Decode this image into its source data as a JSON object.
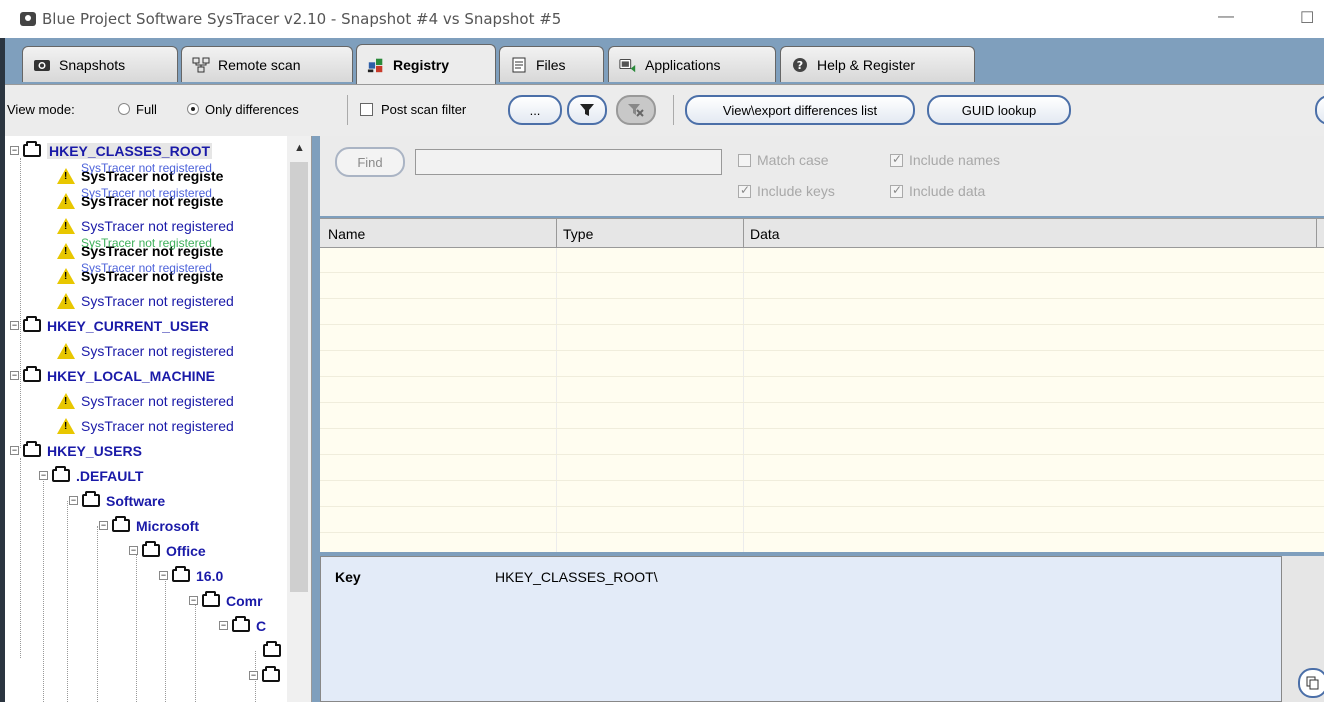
{
  "window": {
    "title": "Blue Project Software SysTracer v2.10 - Snapshot #4 vs Snapshot #5",
    "minimize_glyph": "—",
    "maximize_glyph": "☐"
  },
  "tabs": [
    {
      "label": "Snapshots",
      "icon": "camera-icon"
    },
    {
      "label": "Remote scan",
      "icon": "network-icon"
    },
    {
      "label": "Registry",
      "icon": "registry-icon",
      "active": true
    },
    {
      "label": "Files",
      "icon": "files-icon"
    },
    {
      "label": "Applications",
      "icon": "applications-icon"
    },
    {
      "label": "Help & Register",
      "icon": "help-icon"
    }
  ],
  "toolbar": {
    "view_mode_label": "View mode:",
    "full_label": "Full",
    "only_differences_label": "Only differences",
    "view_mode_selected": "Only differences",
    "post_scan_filter_label": "Post scan filter",
    "post_scan_filter_checked": false,
    "more_button_label": "...",
    "export_button_label": "View\\export differences list",
    "guid_button_label": "GUID lookup"
  },
  "tree": {
    "nodes": [
      {
        "label": "HKEY_CLASSES_ROOT",
        "type": "root",
        "selected": true
      },
      {
        "label": "SysTracer not registered",
        "overlay": "SysTracer not registered",
        "type": "warn-bold",
        "overlay_color": "blue",
        "visible": "SysTracer not registe"
      },
      {
        "label": "SysTracer not registered",
        "overlay": "SysTracer not registered",
        "type": "warn-bold",
        "overlay_color": "blue",
        "visible": "SysTracer not registe"
      },
      {
        "label": "SysTracer not registered",
        "type": "warn"
      },
      {
        "label": "SysTracer not registered",
        "overlay": "SysTracer not registered",
        "type": "warn-bold",
        "overlay_color": "green",
        "visible": "SysTracer not registe"
      },
      {
        "label": "SysTracer not registered",
        "overlay": "SysTracer not registered",
        "type": "warn-bold",
        "overlay_color": "blue",
        "visible": "SysTracer not registe"
      },
      {
        "label": "SysTracer not registered",
        "type": "warn"
      },
      {
        "label": "HKEY_CURRENT_USER",
        "type": "root"
      },
      {
        "label": "SysTracer not registered",
        "type": "warn"
      },
      {
        "label": "HKEY_LOCAL_MACHINE",
        "type": "root"
      },
      {
        "label": "SysTracer not registered",
        "type": "warn"
      },
      {
        "label": "SysTracer not registered",
        "type": "warn"
      },
      {
        "label": "HKEY_USERS",
        "type": "root"
      },
      {
        "label": ".DEFAULT",
        "type": "folder"
      },
      {
        "label": "Software",
        "type": "folder"
      },
      {
        "label": "Microsoft",
        "type": "folder"
      },
      {
        "label": "Office",
        "type": "folder"
      },
      {
        "label": "16.0",
        "type": "folder"
      },
      {
        "label": "Comr",
        "type": "folder"
      },
      {
        "label": "C",
        "type": "folder"
      }
    ]
  },
  "find": {
    "button_label": "Find",
    "input_value": "",
    "match_case_label": "Match case",
    "match_case_checked": false,
    "include_names_label": "Include names",
    "include_names_checked": true,
    "include_keys_label": "Include keys",
    "include_keys_checked": true,
    "include_data_label": "Include data",
    "include_data_checked": true
  },
  "grid": {
    "columns": [
      "Name",
      "Type",
      "Data"
    ],
    "rows": []
  },
  "detail": {
    "key_label": "Key",
    "key_value": "HKEY_CLASSES_ROOT\\"
  },
  "colors": {
    "frame": "#7f9fbd",
    "tree_text": "#1a1aa8",
    "overlay_green": "#2aa84a",
    "overlay_blue": "#3a52d6",
    "warning": "#e8c700",
    "grid_bg": "#fffdf0",
    "detail_bg": "#e3ebf8"
  }
}
